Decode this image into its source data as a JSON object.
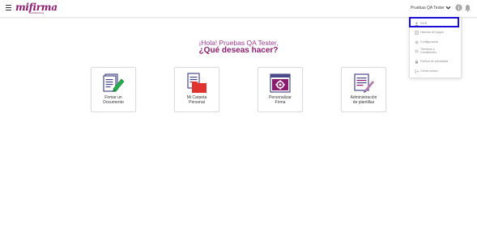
{
  "header": {
    "logo_text": "mifirma",
    "logo_tagline": "EMPRESAS",
    "user_name": "Pruebas QA Tester"
  },
  "main": {
    "greeting": "¡Hola! Pruebas QA Tester,",
    "question": "¿Qué deseas hacer?",
    "cards": [
      {
        "label": "Firmar un\nDocumento"
      },
      {
        "label": "Mi Carpeta\nPersonal"
      },
      {
        "label": "Personalizar\nFirma"
      },
      {
        "label": "Administración\nde plantillas"
      }
    ]
  },
  "dropdown": {
    "items": [
      {
        "label": "Perfil"
      },
      {
        "label": "Historial de pagos"
      },
      {
        "label": "Configuración"
      },
      {
        "label": "Términos y\nCondiciones"
      },
      {
        "label": "Política de privacidad"
      },
      {
        "label": "Cerrar sesión"
      }
    ]
  },
  "colors": {
    "brand": "#8a1c6e",
    "accent_green": "#22b14c",
    "accent_red": "#e0322e",
    "highlight": "#1a0dd8"
  }
}
